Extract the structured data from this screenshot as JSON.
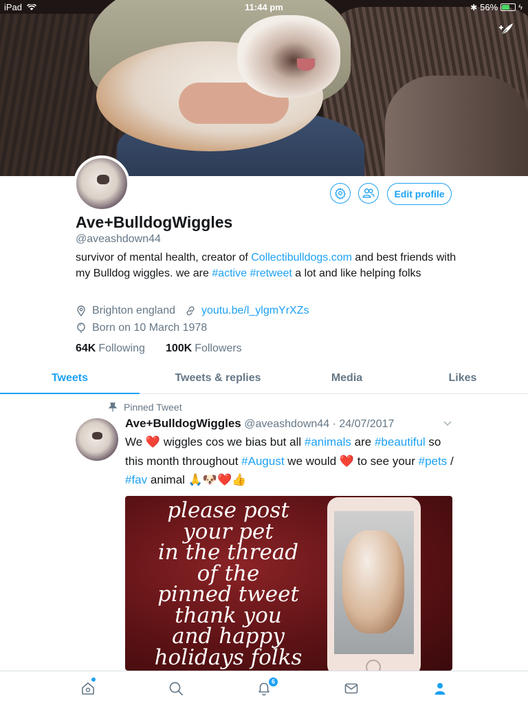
{
  "status_bar": {
    "device": "iPad",
    "time": "11:44 pm",
    "battery": "56%"
  },
  "profile": {
    "display_name": "Ave+BulldogWiggles",
    "handle": "@aveashdown44",
    "bio_pre": "survivor of mental health, creator of ",
    "bio_link": "Collectibulldogs.com",
    "bio_mid": " and best friends with my Bulldog wiggles. we are ",
    "bio_tag1": "#active",
    "bio_space": " ",
    "bio_tag2": "#retweet",
    "bio_post": " a lot and like helping folks",
    "location": "Brighton england",
    "website": "youtu.be/l_ylgmYrXZs",
    "birthday": "Born on 10 March 1978",
    "following_count": "64K",
    "following_label": "Following",
    "followers_count": "100K",
    "followers_label": "Followers",
    "edit_profile_label": "Edit profile"
  },
  "tabs": [
    {
      "label": "Tweets"
    },
    {
      "label": "Tweets & replies"
    },
    {
      "label": "Media"
    },
    {
      "label": "Likes"
    }
  ],
  "tweet": {
    "pinned_label": "Pinned Tweet",
    "name": "Ave+BulldogWiggles",
    "handle_date": "@aveashdown44 · 24/07/2017",
    "t1": "We ",
    "heart": "❤️",
    "t2": " wiggles cos we bias but all ",
    "tag_animals": "#animals",
    "t3": " are ",
    "tag_beautiful": "#beautiful",
    "t4": " so this month throughout ",
    "tag_august": "#August",
    "t5": " we would ",
    "t6": " to see your ",
    "tag_pets": "#pets",
    "t7": " / ",
    "tag_fav": "#fav",
    "t8": " animal ",
    "emojis": "🙏🐶❤️👍",
    "media_text_lines": [
      "please post",
      "your pet",
      "in the thread",
      "of the",
      "pinned tweet",
      "thank you",
      "and happy",
      "holidays folks"
    ]
  },
  "tab_bar": {
    "notification_count": "6"
  },
  "colors": {
    "accent": "#1da1f2",
    "secondary_text": "#657786",
    "heart": "#e0245e"
  }
}
